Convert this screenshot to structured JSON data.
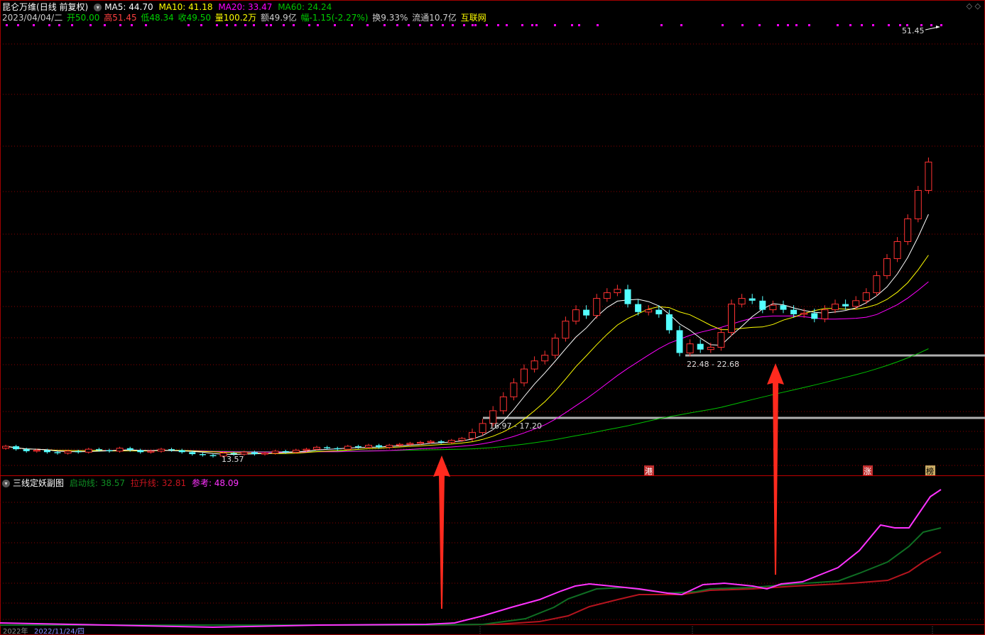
{
  "header": {
    "stock_name": "昆仑万维",
    "chart_mode": "(日线 前复权)",
    "ma5": "MA5: 44.70",
    "ma10": "MA10: 41.18",
    "ma20": "MA20: 33.47",
    "ma60": "MA60: 24.24",
    "date": "2023/04/04/二",
    "open": "开50.00",
    "high": "高51.45",
    "low": "低48.34",
    "close": "收49.50",
    "volume": "量100.2万",
    "amount": "额49.9亿",
    "change": "幅-1.15(-2.27%)",
    "turnover": "换9.33%",
    "float_cap": "流通10.7亿",
    "concept": "互联网"
  },
  "annotations": {
    "high_price": "51.45",
    "low_price": "13.57",
    "level1": "16.97 - 17.20",
    "level2": "22.48 - 22.68",
    "badge1": "港",
    "badge2": "涨",
    "badge3": "榜"
  },
  "sub_header": {
    "title": "三线定妖副图",
    "line1": "启动线: 38.57",
    "line2": "拉升线: 32.81",
    "line3": "参考: 48.09"
  },
  "bottom": {
    "date_left": "2022年",
    "date_sel": "2022/11/24/四"
  },
  "colors": {
    "up": "#ff3232",
    "down": "#54ffff",
    "ma5": "#ffffff",
    "ma10": "#ffff00",
    "ma20": "#ff00ff",
    "ma60": "#00c000",
    "grid": "#8b0000",
    "level": "#b0b0b0",
    "sub1": "#0f6e23",
    "sub2": "#b4141e",
    "sub3": "#ff32ff"
  },
  "chart_data": {
    "type": "candlestick",
    "series": [
      {
        "name": "启动线",
        "value": 38.57
      },
      {
        "name": "拉升线",
        "value": 32.81
      },
      {
        "name": "参考",
        "value": 48.09
      }
    ]
  }
}
